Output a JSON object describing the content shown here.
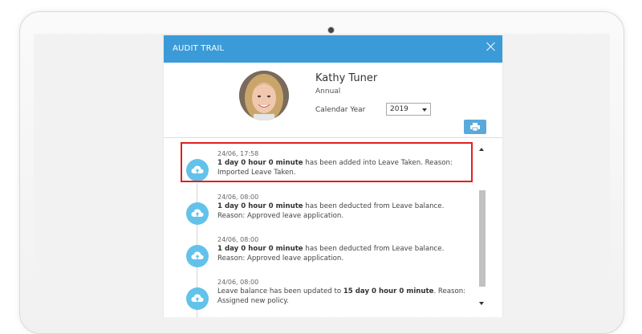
{
  "modal": {
    "title": "AUDIT TRAIL",
    "close_icon": "close-icon"
  },
  "employee": {
    "name": "Kathy Tuner",
    "leave_type": "Annual",
    "calendar_year_label": "Calendar Year",
    "calendar_year_value": "2019"
  },
  "print_icon": "printer-icon",
  "entries": [
    {
      "time": "24/06, 17:58",
      "bold1": "1 day 0 hour 0 minute",
      "text1": " has been added into Leave Taken. Reason: Imported Leave Taken.",
      "icon": "cloud-upload-icon"
    },
    {
      "time": "24/06, 08:00",
      "bold1": "1 day 0 hour 0 minute",
      "text1": " has been deducted from Leave balance. Reason: Approved leave application.",
      "icon": "cloud-upload-icon"
    },
    {
      "time": "24/06, 08:00",
      "bold1": "1 day 0 hour 0 minute",
      "text1": " has been deducted from Leave balance. Reason: Approved leave application.",
      "icon": "cloud-upload-icon"
    },
    {
      "time": "24/06, 08:00",
      "text0": "Leave balance has been updated to ",
      "bold1": "15 day 0 hour 0 minute",
      "text1": ". Reason: Assigned new policy.",
      "icon": "cloud-upload-icon"
    }
  ],
  "colors": {
    "header": "#3b9bd8",
    "icon_circle": "#62c2ea",
    "print_button": "#5aa9da",
    "highlight": "#e02020"
  }
}
